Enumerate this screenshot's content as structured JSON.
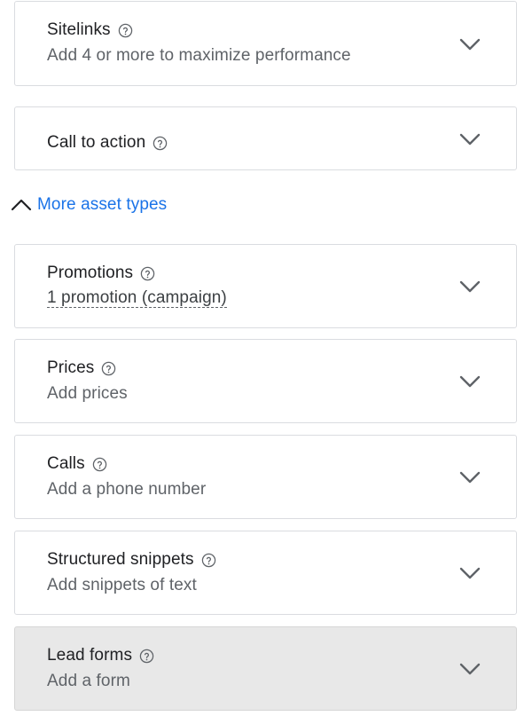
{
  "sections": [
    {
      "title": "Sitelinks",
      "subtitle": "Add 4 or more to maximize performance"
    },
    {
      "title": "Call to action",
      "subtitle": ""
    }
  ],
  "more_asset_types": {
    "label": "More asset types"
  },
  "asset_types": [
    {
      "title": "Promotions",
      "subtitle": "1 promotion (campaign)"
    },
    {
      "title": "Prices",
      "subtitle": "Add prices"
    },
    {
      "title": "Calls",
      "subtitle": "Add a phone number"
    },
    {
      "title": "Structured snippets",
      "subtitle": "Add snippets of text"
    },
    {
      "title": "Lead forms",
      "subtitle": "Add a form"
    }
  ],
  "colors": {
    "link": "#1a73e8",
    "text": "#202124",
    "subtext": "#5f6368",
    "border": "#dadce0",
    "highlight_bg": "#e8e8e8"
  }
}
